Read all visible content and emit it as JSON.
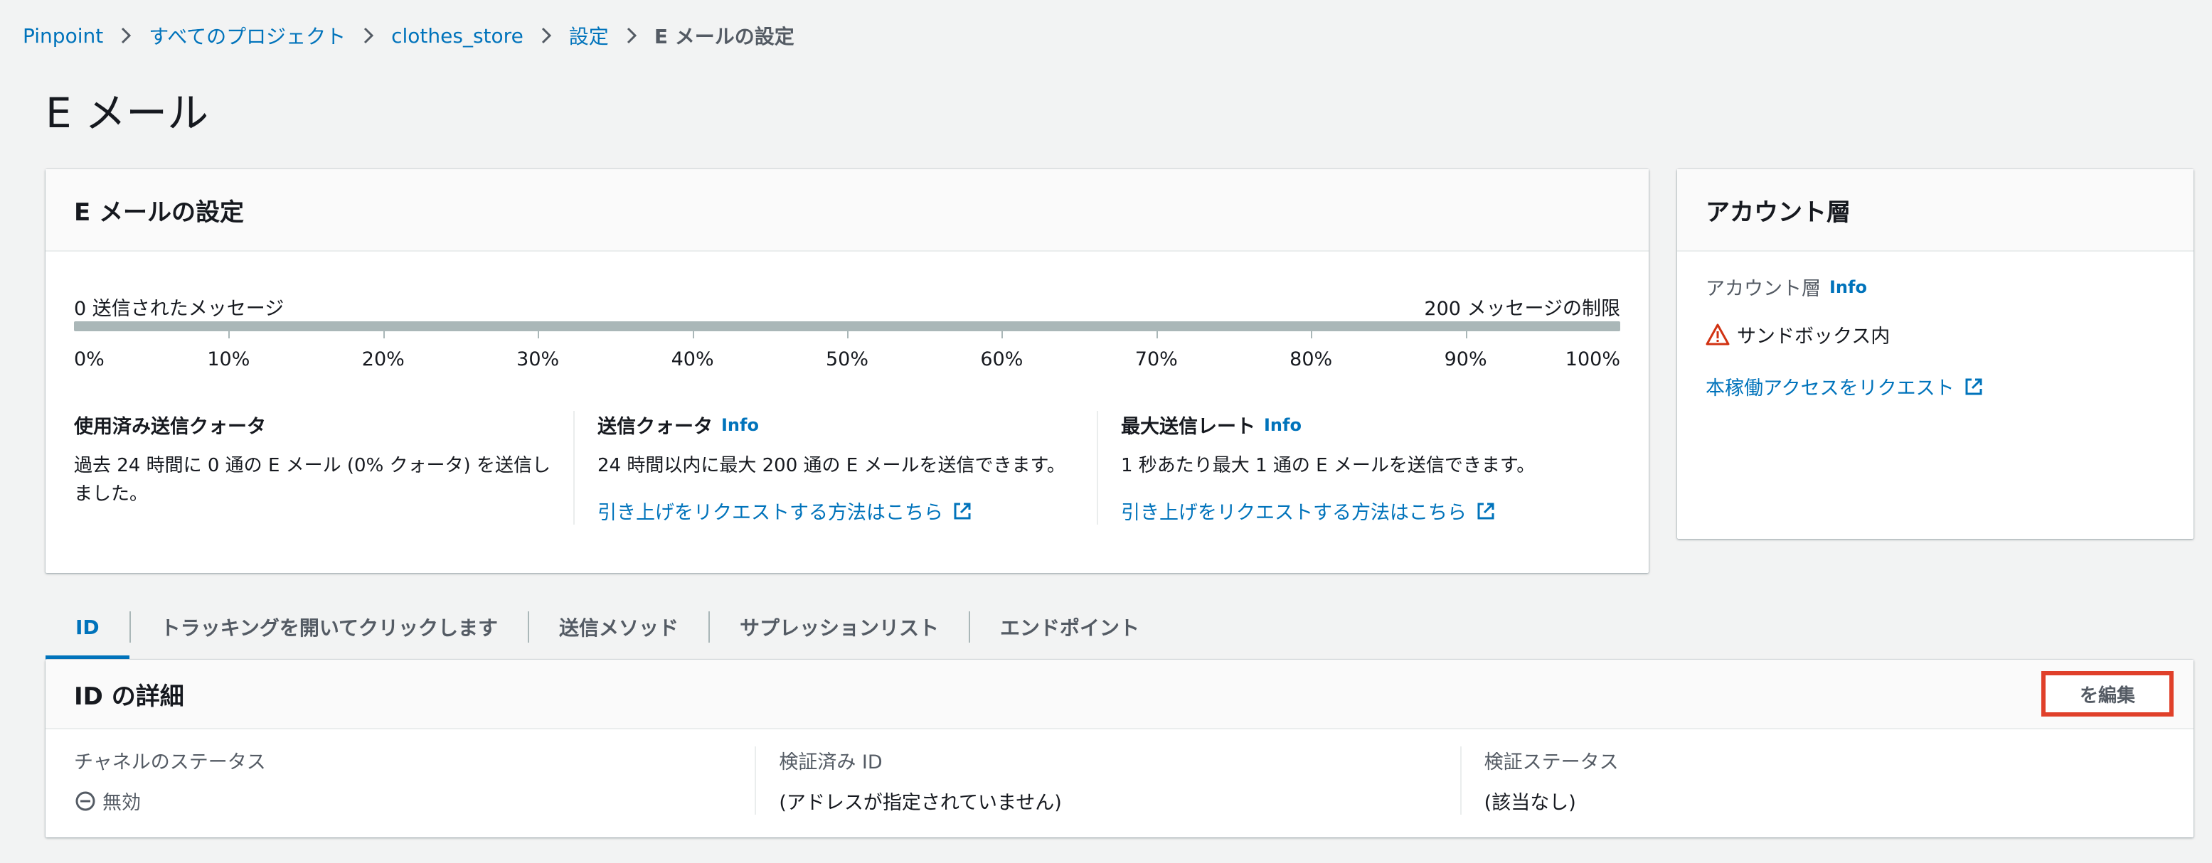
{
  "breadcrumb": {
    "items": [
      "Pinpoint",
      "すべてのプロジェクト",
      "clothes_store",
      "設定"
    ],
    "current": "E メールの設定"
  },
  "page_title": "E メール",
  "email_settings": {
    "title": "E メールの設定",
    "sent_label": "0 送信されたメッセージ",
    "limit_label": "200 メッセージの制限",
    "usage_fraction": 0,
    "ticks": [
      "0%",
      "10%",
      "20%",
      "30%",
      "40%",
      "50%",
      "60%",
      "70%",
      "80%",
      "90%",
      "100%"
    ],
    "used_quota": {
      "heading": "使用済み送信クォータ",
      "text": "過去 24 時間に 0 通の E メール (0% クォータ) を送信しました。"
    },
    "send_quota": {
      "heading": "送信クォータ",
      "info": "Info",
      "text": "24 時間以内に最大 200 通の E メールを送信できます。",
      "link": "引き上げをリクエストする方法はこちら"
    },
    "max_rate": {
      "heading": "最大送信レート",
      "info": "Info",
      "text": "1 秒あたり最大 1 通の E メールを送信できます。",
      "link": "引き上げをリクエストする方法はこちら"
    }
  },
  "account_tier": {
    "title": "アカウント層",
    "label": "アカウント層",
    "info": "Info",
    "status": "サンドボックス内",
    "link": "本稼働アクセスをリクエスト"
  },
  "tabs": [
    "ID",
    "トラッキングを開いてクリックします",
    "送信メソッド",
    "サプレッションリスト",
    "エンドポイント"
  ],
  "identity": {
    "title": "ID の詳細",
    "edit_label": "を編集",
    "columns": [
      {
        "label": "チャネルのステータス",
        "value": "無効"
      },
      {
        "label": "検証済み ID",
        "value": "(アドレスが指定されていません)"
      },
      {
        "label": "検証ステータス",
        "value": "(該当なし)"
      }
    ]
  },
  "colors": {
    "link": "#0073bb",
    "warning": "#d13212",
    "highlight_border": "#e0402a"
  }
}
